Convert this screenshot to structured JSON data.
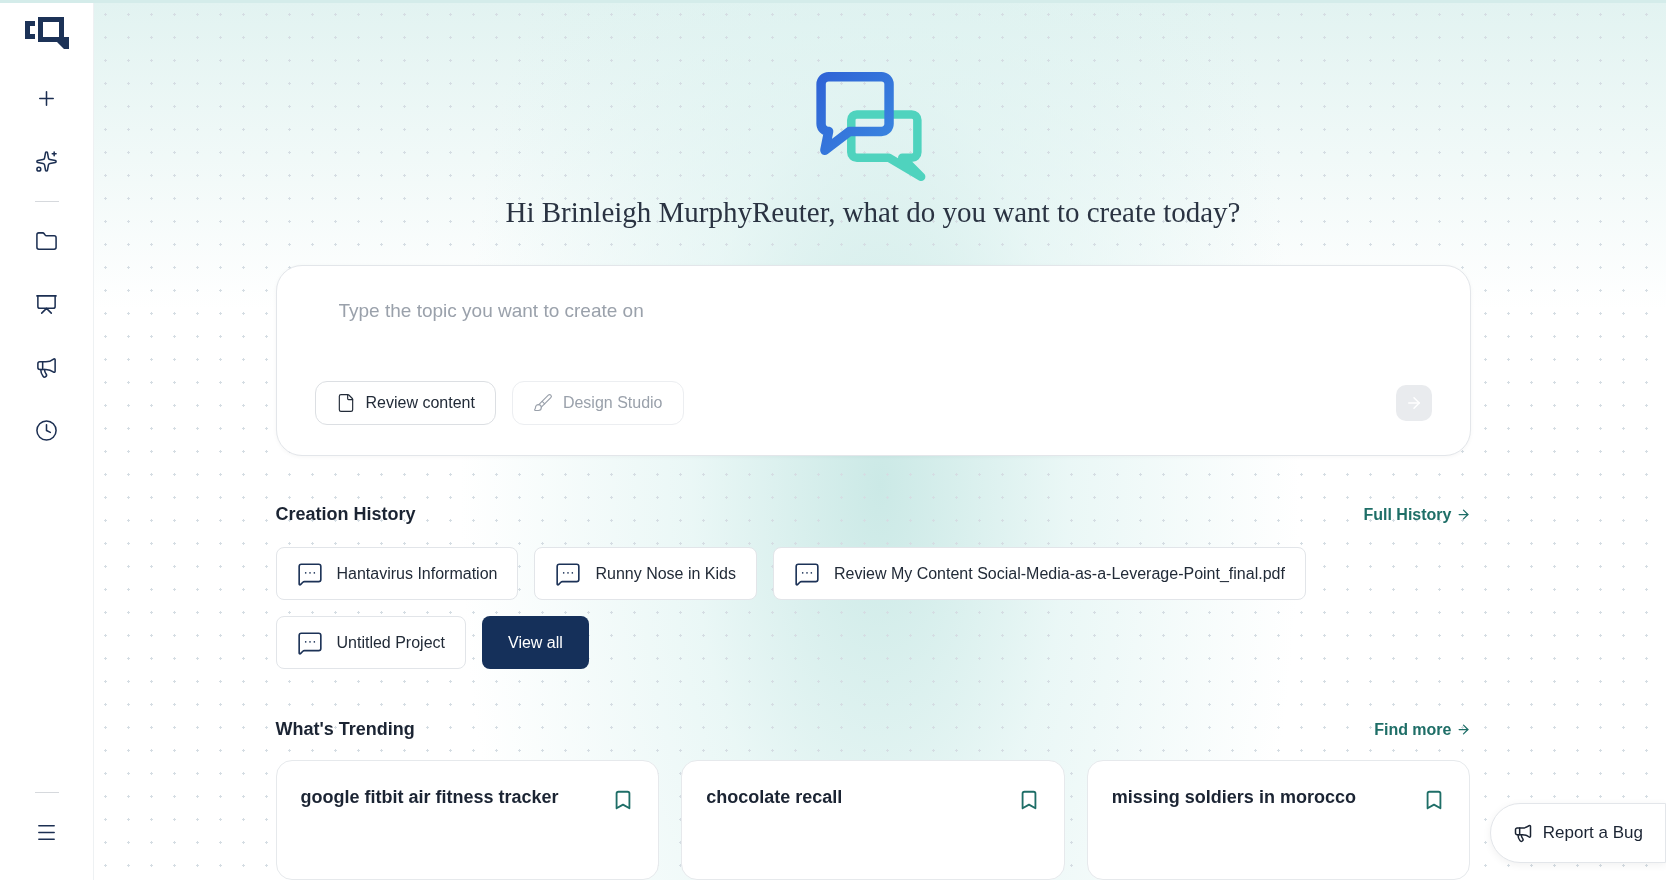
{
  "greeting": "Hi Brinleigh MurphyReuter, what do you want to create today?",
  "prompt": {
    "placeholder": "Type the topic you want to create on",
    "actions": [
      {
        "kind": "review",
        "label": "Review content",
        "disabled": false
      },
      {
        "kind": "design",
        "label": "Design Studio",
        "disabled": true
      }
    ],
    "send": {
      "disabled": true
    }
  },
  "history": {
    "title": "Creation History",
    "link": "Full History",
    "view_all": "View all",
    "items": [
      {
        "title": "Hantavirus Information"
      },
      {
        "title": "Runny Nose in Kids"
      },
      {
        "title": "Review My Content Social-Media-as-a-Leverage-Point_final.pdf"
      },
      {
        "title": "Untitled Project"
      }
    ]
  },
  "trending": {
    "title": "What's Trending",
    "link": "Find more",
    "items": [
      {
        "title": "google fitbit air fitness tracker"
      },
      {
        "title": "chocolate recall"
      },
      {
        "title": "missing soldiers in morocco"
      }
    ]
  },
  "report_bug": "Report a Bug"
}
